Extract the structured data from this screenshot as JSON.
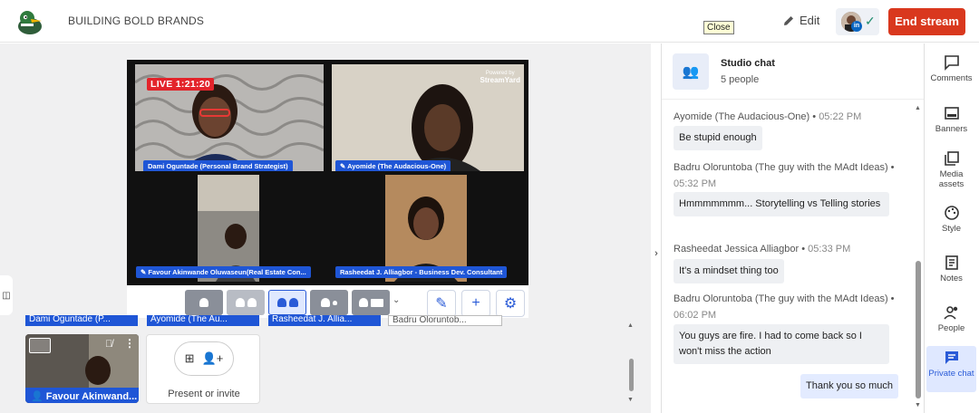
{
  "header": {
    "brand": "BUILDING BOLD BRANDS",
    "tooltip": "Close",
    "edit_label": "Edit",
    "end_stream_label": "End stream"
  },
  "stream": {
    "live_badge": "LIVE 1:21:20",
    "powered_by": "Powered by",
    "powered_brand": "StreamYard",
    "tiles": [
      {
        "name": "Dami Oguntade (Personal Brand Strategist)"
      },
      {
        "name": "Ayomide (The Audacious-One)"
      },
      {
        "name": "Favour Akinwande Oluwaseun(Real Estate Con..."
      },
      {
        "name": "Rasheedat J. Alliagbor - Business Dev. Consultant"
      }
    ]
  },
  "backstage": {
    "labels": [
      "Dami Oguntade (P...",
      "Ayomide (The Au...",
      "Rasheedat J. Allia...",
      "Badru Oloruntob..."
    ],
    "thumb_name": "Favour Akinwand...",
    "present_label": "Present or invite"
  },
  "chat": {
    "title": "Studio chat",
    "subtitle": "5 people",
    "messages": [
      {
        "author": "Ayomide (The Audacious-One)",
        "time": "05:22 PM",
        "text": "Be stupid enough"
      },
      {
        "author": "Badru Oloruntoba (The guy with the MAdt Ideas)",
        "time": "05:32 PM",
        "text": "Hmmmmmmm... Storytelling vs Telling stories"
      },
      {
        "author": "Rasheedat Jessica Alliagbor",
        "time": "05:33 PM",
        "text": "It's a mindset thing too"
      },
      {
        "author": "Badru Oloruntoba (The guy with the MAdt Ideas)",
        "time": "06:02 PM",
        "text": "You guys are fire. I had to come back so I won't miss the action"
      }
    ],
    "my_message": "Thank you so much"
  },
  "rail": {
    "items": [
      {
        "label": "Comments",
        "icon": "comment-icon"
      },
      {
        "label": "Banners",
        "icon": "banner-icon"
      },
      {
        "label": "Media assets",
        "icon": "media-icon"
      },
      {
        "label": "Style",
        "icon": "palette-icon"
      },
      {
        "label": "Notes",
        "icon": "notes-icon"
      },
      {
        "label": "People",
        "icon": "people-icon"
      },
      {
        "label": "Private chat",
        "icon": "chat-icon"
      }
    ]
  },
  "colors": {
    "accent": "#2a5bd7",
    "end_stream": "#d9381e",
    "name_tag": "#1f56d6",
    "live": "#e3242b"
  }
}
